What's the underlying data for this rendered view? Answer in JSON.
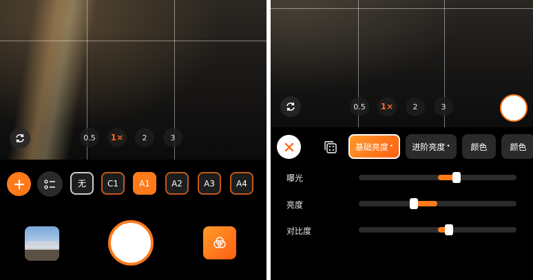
{
  "left_screen": {
    "zoom_levels": [
      "0.5",
      "1×",
      "2",
      "3"
    ],
    "active_zoom": "1×",
    "preset_chips": [
      "无",
      "C1",
      "A1",
      "A2",
      "A3",
      "A4"
    ],
    "active_preset": "A1",
    "icons": {
      "rotate": "rotate-camera-icon",
      "add": "plus-icon",
      "list": "checklist-icon",
      "filter": "filter-overlap-icon"
    }
  },
  "right_screen": {
    "zoom_levels": [
      "0.5",
      "1×",
      "2",
      "3"
    ],
    "active_zoom": "1×",
    "tabs": [
      {
        "label": "基础亮度",
        "dot": "•"
      },
      {
        "label": "进阶亮度",
        "dot": "•"
      },
      {
        "label": "颜色",
        "dot": ""
      },
      {
        "label": "颜色",
        "dot": ""
      }
    ],
    "active_tab": 0,
    "sliders": [
      {
        "label": "曝光",
        "from": 0.5,
        "to": 0.62
      },
      {
        "label": "亮度",
        "from": 0.35,
        "to": 0.5
      },
      {
        "label": "对比度",
        "from": 0.5,
        "to": 0.57
      }
    ],
    "icons": {
      "close": "close-icon",
      "dice": "dice-icon",
      "rotate": "rotate-camera-icon"
    }
  },
  "colors": {
    "accent": "#ff7a1a",
    "background": "#000000"
  }
}
